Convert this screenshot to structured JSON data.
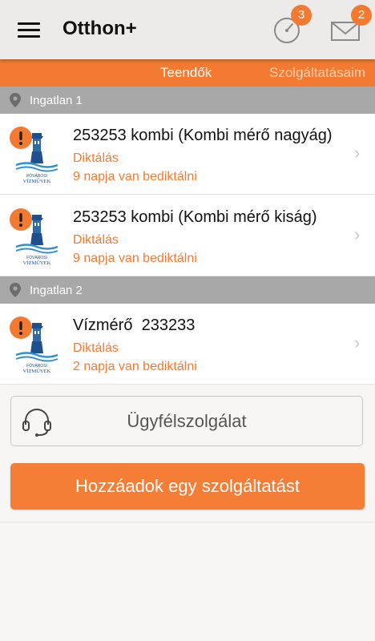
{
  "header": {
    "title": "Otthon+",
    "menu_icon": "hamburger-menu-icon",
    "notifications_badge": "3",
    "messages_badge": "2"
  },
  "tabs": [
    {
      "label": "Teendők",
      "active": true
    },
    {
      "label": "Szolgáltatásaim",
      "active": false
    }
  ],
  "sections": [
    {
      "label": "Ingatlan 1",
      "items": [
        {
          "title": "253253 kombi (Kombi mérő nagyág)",
          "subtitle": "Diktálás",
          "status": "9 napja van bediktálni"
        },
        {
          "title": "253253 kombi (Kombi mérő kiság)",
          "subtitle": "Diktálás",
          "status": "9 napja van bediktálni"
        }
      ]
    },
    {
      "label": "Ingatlan 2",
      "items": [
        {
          "title": "Vízmérő  233233",
          "subtitle": "Diktálás",
          "status": "2 napja van bediktálni"
        }
      ]
    }
  ],
  "logo_text": {
    "line1": "FŐVÁROSI",
    "line2": "VÍZMŰVEK"
  },
  "support_button": {
    "label": "Ügyfélszolgálat"
  },
  "add_button": {
    "label": "Hozzáadok egy szolgáltatást"
  },
  "colors": {
    "accent": "#f37a30",
    "section_header": "#a8a8a8",
    "background": "#f7f6f4",
    "alert_red": "#e2412f"
  }
}
